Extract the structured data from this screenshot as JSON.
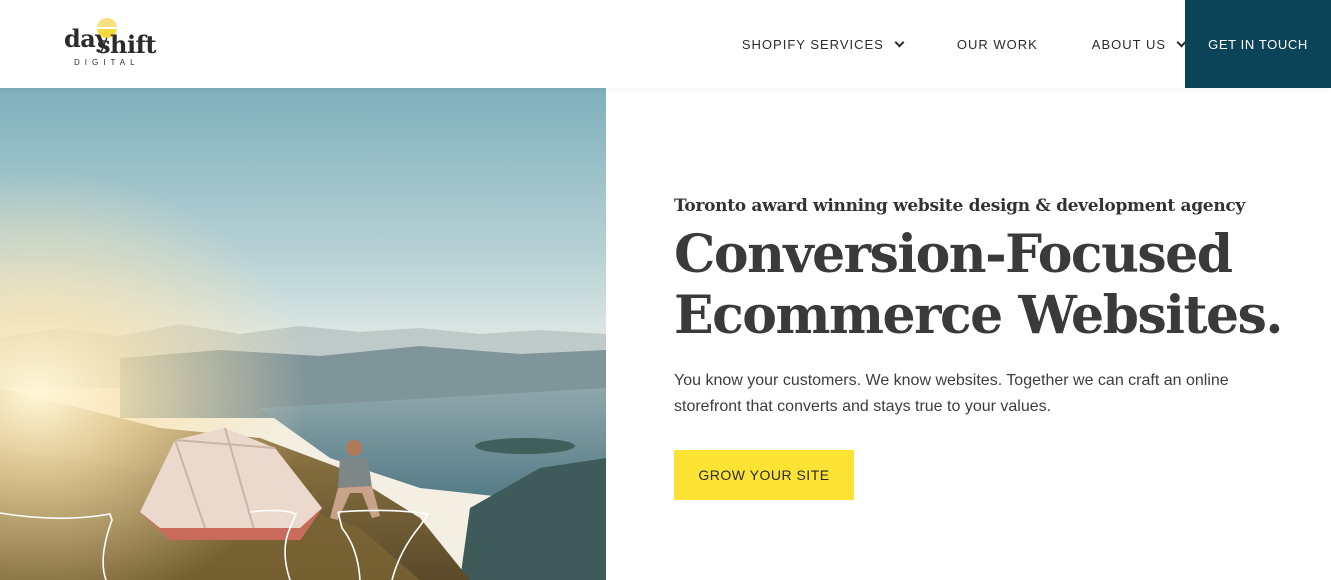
{
  "logo": {
    "day": "day",
    "shift": "shift",
    "digital": "DIGITAL"
  },
  "nav": {
    "items": [
      {
        "label": "SHOPIFY SERVICES",
        "has_dropdown": true
      },
      {
        "label": "OUR WORK",
        "has_dropdown": false
      },
      {
        "label": "ABOUT US",
        "has_dropdown": true
      }
    ],
    "cta_label": "GET IN TOUCH"
  },
  "hero": {
    "eyebrow": "Toronto award winning website design & development agency",
    "headline_line1": "Conversion-Focused",
    "headline_line2": "Ecommerce Websites.",
    "body": "You know your customers. We know websites. Together we can craft an online storefront that converts and stays true to your values.",
    "cta_label": "GROW YOUR SITE"
  },
  "colors": {
    "brand_dark": "#0b4459",
    "cta_yellow": "#fde333",
    "text_dark": "#333333"
  },
  "icons": {
    "chevron": "chevron-down-icon",
    "logo_sun": "sun-icon"
  }
}
